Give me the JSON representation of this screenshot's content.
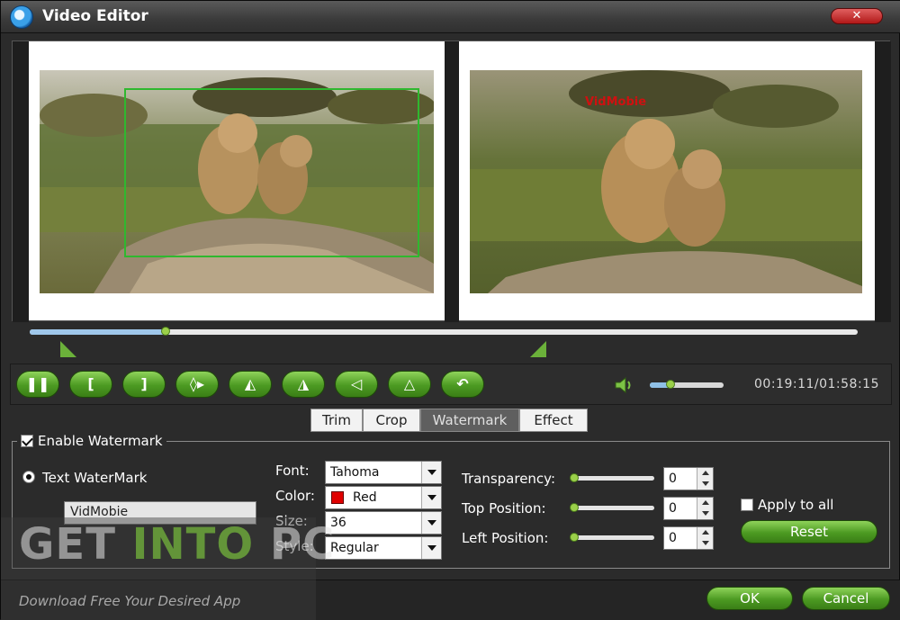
{
  "window": {
    "title": "Video Editor",
    "close_label": "✕"
  },
  "preview": {
    "watermark_text": "VidMobie"
  },
  "timeline": {
    "progress": 0.164
  },
  "toolbar": {
    "buttons": [
      {
        "name": "pause-button",
        "glyph": "❚❚"
      },
      {
        "name": "set-start-button",
        "glyph": "["
      },
      {
        "name": "set-end-button",
        "glyph": "]"
      },
      {
        "name": "split-button",
        "glyph": "◊▸"
      },
      {
        "name": "flip-left-button",
        "glyph": "◭"
      },
      {
        "name": "flip-right-button",
        "glyph": "◮"
      },
      {
        "name": "rotate-left-button",
        "glyph": "◁"
      },
      {
        "name": "mirror-button",
        "glyph": "△"
      },
      {
        "name": "undo-button",
        "glyph": "↶"
      }
    ],
    "volume": 0.28,
    "timecode": "00:19:11/01:58:15"
  },
  "tabs": [
    "Trim",
    "Crop",
    "Watermark",
    "Effect"
  ],
  "active_tab": "Watermark",
  "watermark": {
    "enable_label": "Enable Watermark",
    "enable_checked": true,
    "text_mode_label": "Text WaterMark",
    "text_value": "VidMobie",
    "font_label": "Font:",
    "font_value": "Tahoma",
    "color_label": "Color:",
    "color_value": "Red",
    "color_hex": "#e00000",
    "size_label": "Size:",
    "size_value": "36",
    "style_label": "Style:",
    "style_value": "Regular",
    "transparency_label": "Transparency:",
    "transparency_value": "0",
    "top_label": "Top Position:",
    "top_value": "0",
    "left_label": "Left Position:",
    "left_value": "0",
    "apply_all_label": "Apply to all",
    "apply_all_checked": false,
    "reset_label": "Reset"
  },
  "footer": {
    "ok_label": "OK",
    "cancel_label": "Cancel"
  },
  "overlay": {
    "logo_part1": "GET ",
    "logo_part2": "INTO",
    "logo_part3": " PC",
    "tagline": "Download Free Your Desired App"
  },
  "colors": {
    "accent_green": "#4c9a22",
    "crop_box": "#2fb82f",
    "watermark_red": "#d01010"
  }
}
